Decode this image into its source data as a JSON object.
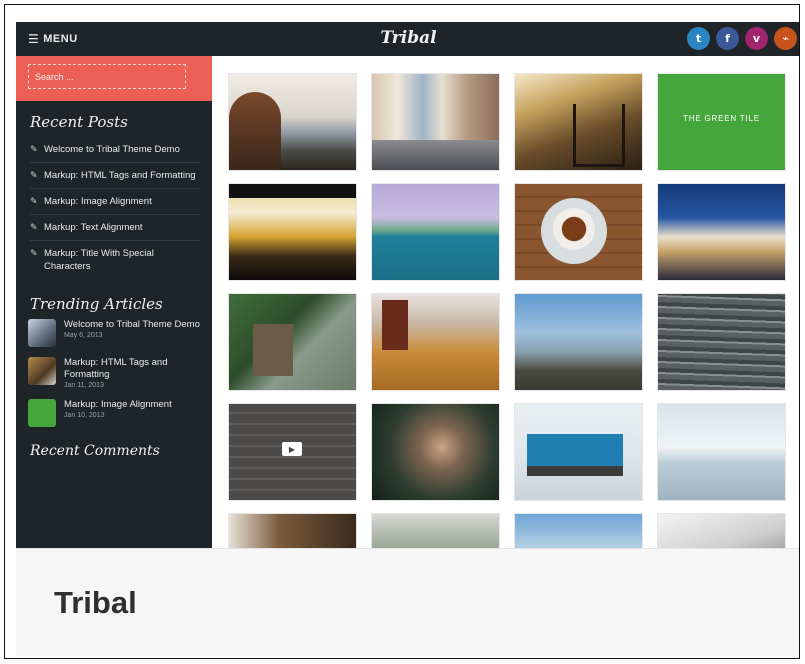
{
  "topbar": {
    "menu_label": "MENU",
    "site_title": "Tribal",
    "social": [
      {
        "icon": "twitter-icon",
        "glyph": "t",
        "color": "#2a86c3"
      },
      {
        "icon": "facebook-icon",
        "glyph": "f",
        "color": "#3b5998"
      },
      {
        "icon": "vimeo-icon",
        "glyph": "v",
        "color": "#a0246e"
      },
      {
        "icon": "rss-icon",
        "glyph": "⌁",
        "color": "#c8531b"
      }
    ]
  },
  "sidebar": {
    "search_placeholder": "Search ...",
    "recent_posts_title": "Recent Posts",
    "recent_posts": [
      "Welcome to Tribal Theme Demo",
      "Markup: HTML Tags and Formatting",
      "Markup: Image Alignment",
      "Markup: Text Alignment",
      "Markup: Title With Special Characters"
    ],
    "trending_title": "Trending Articles",
    "trending": [
      {
        "title": "Welcome to Tribal Theme Demo",
        "date": "May 6, 2013"
      },
      {
        "title": "Markup: HTML Tags and Formatting",
        "date": "Jan 11, 2013"
      },
      {
        "title": "Markup: Image Alignment",
        "date": "Jan 10, 2013"
      }
    ],
    "more_title": "Recent Comments"
  },
  "grid": {
    "green_tile_text": "THE GREEN TILE"
  },
  "caption": {
    "title": "Tribal"
  }
}
